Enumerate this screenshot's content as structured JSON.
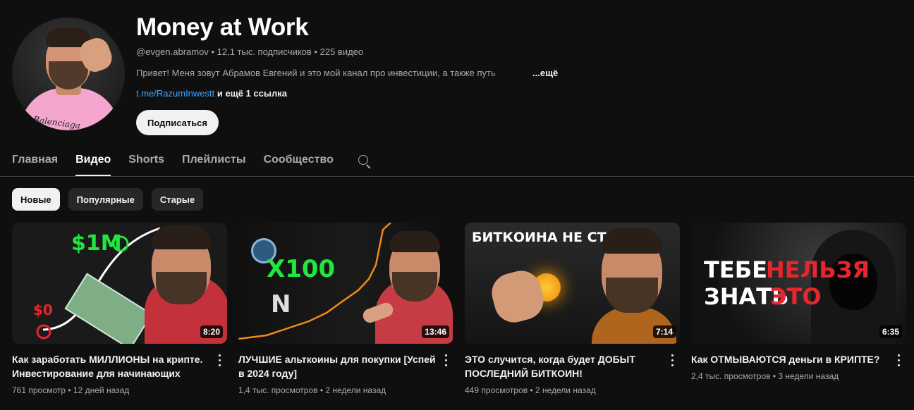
{
  "channel": {
    "title": "Money at Work",
    "handle": "@evgen.abramov",
    "subscribers": "12,1 тыс. подписчиков",
    "video_count": "225 видео",
    "meta_separator": "•",
    "description": "Привет! Меня зовут Абрамов Евгений и это мой канал про инвестиции, а также путь",
    "description_more": "...ещё",
    "link": "t.me/RazumInwestt",
    "more_links": "и ещё 1 ссылка",
    "subscribe_label": "Подписаться",
    "avatar_shirt_text": "Balenciaga"
  },
  "tabs": [
    {
      "label": "Главная",
      "active": false
    },
    {
      "label": "Видео",
      "active": true
    },
    {
      "label": "Shorts",
      "active": false
    },
    {
      "label": "Плейлисты",
      "active": false
    },
    {
      "label": "Сообщество",
      "active": false
    }
  ],
  "chips": [
    {
      "label": "Новые",
      "active": true
    },
    {
      "label": "Популярные",
      "active": false
    },
    {
      "label": "Старые",
      "active": false
    }
  ],
  "videos": [
    {
      "title": "Как заработать МИЛЛИОНЫ на крипте. Инвестирование для начинающих",
      "views": "761 просмотр",
      "age": "12 дней назад",
      "duration": "8:20",
      "thumb_text": [
        "$1M",
        "$0"
      ]
    },
    {
      "title": "ЛУЧШИЕ альткоины для покупки [Успей в 2024 году]",
      "views": "1,4 тыс. просмотров",
      "age": "2 недели назад",
      "duration": "13:46",
      "thumb_text": [
        "X100"
      ]
    },
    {
      "title": "ЭТО случится, когда будет ДОБЫТ ПОСЛЕДНИЙ БИТКОИН!",
      "views": "449 просмотров",
      "age": "2 недели назад",
      "duration": "7:14",
      "thumb_text": [
        "БИТКОИНА НЕ СТАНЕТ"
      ]
    },
    {
      "title": "Как ОТМЫВАЮТСЯ деньги в КРИПТЕ?",
      "views": "2,4 тыс. просмотров",
      "age": "3 недели назад",
      "duration": "6:35",
      "thumb_text": [
        "ТЕБЕ",
        "НЕЛЬЗЯ",
        "ЗНАТЬ",
        "ЭТО"
      ]
    }
  ],
  "colors": {
    "background": "#0f0f0f",
    "link": "#3ea6ff",
    "neon_green": "#21e640",
    "alert_red": "#e5262c"
  }
}
